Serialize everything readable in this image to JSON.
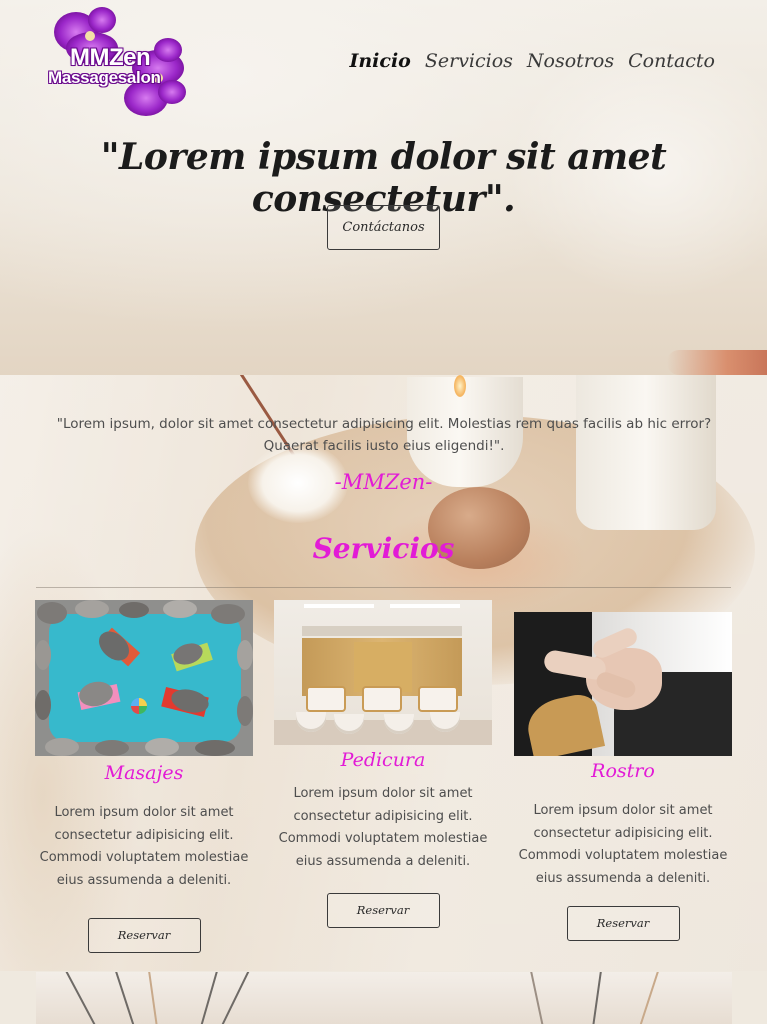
{
  "brand": {
    "logo_main": "MMZen",
    "logo_sub": "Massagesalon"
  },
  "nav": {
    "items": [
      {
        "label": "Inicio",
        "active": true
      },
      {
        "label": "Servicios",
        "active": false
      },
      {
        "label": "Nosotros",
        "active": false
      },
      {
        "label": "Contacto",
        "active": false
      }
    ]
  },
  "hero": {
    "quote": "\"Lorem ipsum dolor sit amet consectetur\".",
    "button_label": "Contáctanos"
  },
  "testimonial": {
    "text": "\"Lorem ipsum, dolor sit amet consectetur adipisicing elit. Molestias rem quas facilis ab hic error? Quaerat facilis iusto eius eligendi!\".",
    "signature": "-MMZen-"
  },
  "services": {
    "title": "Servicios",
    "cards": [
      {
        "title": "Masajes",
        "image": "hot-stones-massage-photo",
        "description": "Lorem ipsum dolor sit amet consectetur adipisicing elit. Commodi voluptatem molestiae eius assumenda a deleniti.",
        "button_label": "Reservar"
      },
      {
        "title": "Pedicura",
        "image": "pedicure-salon-photo",
        "description": "Lorem ipsum dolor sit amet consectetur adipisicing elit. Commodi voluptatem molestiae eius assumenda a deleniti.",
        "button_label": "Reservar"
      },
      {
        "title": "Rostro",
        "image": "facial-treatment-photo",
        "description": "Lorem ipsum dolor sit amet consectetur adipisicing elit. Commodi voluptatem molestiae eius assumenda a deleniti.",
        "button_label": "Reservar"
      }
    ]
  },
  "colors": {
    "accent": "#e21bd6",
    "text_dark": "#1b1b1b",
    "logo_purple": "#6a0a8c"
  }
}
